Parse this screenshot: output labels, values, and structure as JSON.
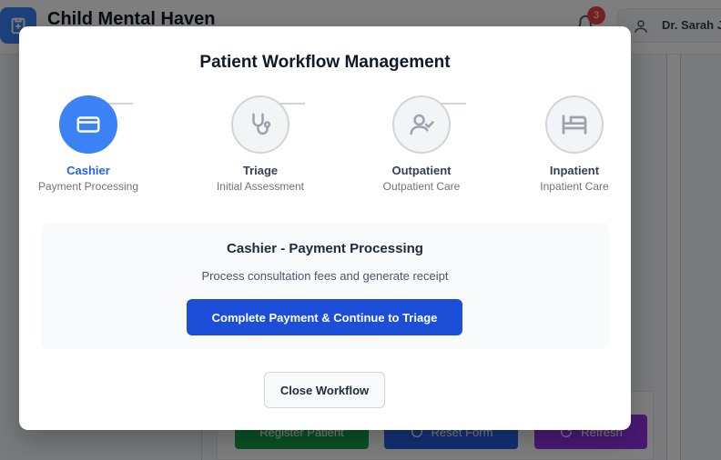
{
  "app": {
    "title": "Child Mental Haven",
    "notification_count": "3",
    "user_name": "Dr. Sarah J"
  },
  "background_actions": {
    "register": "Register Patient",
    "reset": "Reset Form",
    "refresh": "Refresh"
  },
  "modal": {
    "title": "Patient Workflow Management",
    "steps": [
      {
        "label": "Cashier",
        "sub": "Payment Processing",
        "icon": "credit-card-icon",
        "active": true
      },
      {
        "label": "Triage",
        "sub": "Initial Assessment",
        "icon": "stethoscope-icon",
        "active": false
      },
      {
        "label": "Outpatient",
        "sub": "Outpatient Care",
        "icon": "user-check-icon",
        "active": false
      },
      {
        "label": "Inpatient",
        "sub": "Inpatient Care",
        "icon": "bed-icon",
        "active": false
      }
    ],
    "current_step": {
      "title": "Cashier - Payment Processing",
      "description": "Process consultation fees and generate receipt",
      "action_label": "Complete Payment & Continue to Triage"
    },
    "close_label": "Close Workflow"
  },
  "colors": {
    "accent": "#3b82f6",
    "primary_button": "#1d4ed8",
    "badge": "#ef4444"
  }
}
